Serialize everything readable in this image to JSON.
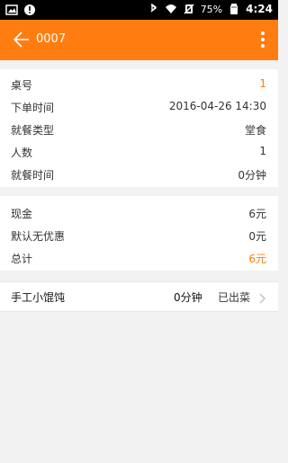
{
  "status_bar": {
    "left_icons": [
      "image-icon",
      "info-icon"
    ],
    "right_icons": [
      "bluetooth-icon",
      "wifi-icon",
      "mute-icon",
      "battery-icon"
    ],
    "battery": "75%",
    "time": "4:24"
  },
  "app_bar": {
    "title": "0007",
    "back_icon": "back-arrow-icon",
    "menu_icon": "more-vert-icon",
    "bg": "#ff7d10"
  },
  "order_info": [
    {
      "label": "桌号",
      "value": "1",
      "accent": true
    },
    {
      "label": "下单时间",
      "value": "2016-04-26 14:30"
    },
    {
      "label": "就餐类型",
      "value": "堂食"
    },
    {
      "label": "人数",
      "value": "1"
    },
    {
      "label": "就餐时间",
      "value": "0分钟"
    }
  ],
  "payment": [
    {
      "label": "现金",
      "value": "6元"
    },
    {
      "label": "默认无优惠",
      "value": "0元"
    },
    {
      "label": "总计",
      "value": "6元",
      "accent": true
    }
  ],
  "dishes": [
    {
      "name": "手工小馄饨",
      "time": "0分钟",
      "status": "已出菜"
    }
  ],
  "colors": {
    "accent": "#ff7d10",
    "background": "#f2f2f2"
  }
}
